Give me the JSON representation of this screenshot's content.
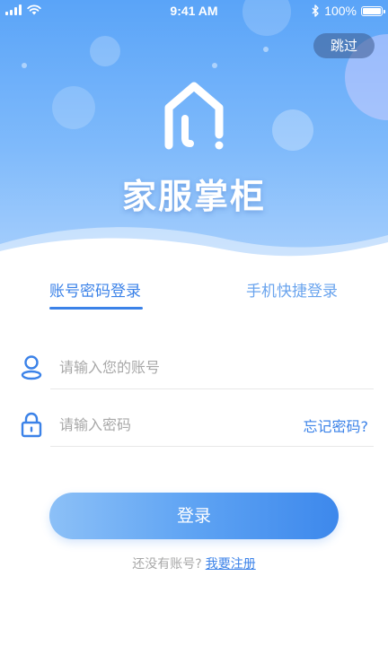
{
  "status_bar": {
    "time": "9:41 AM",
    "battery_percent": "100%",
    "battery_level": 1.0,
    "icons": [
      "signal-bars-icon",
      "wifi-icon",
      "bluetooth-icon",
      "battery-icon"
    ]
  },
  "header": {
    "skip_label": "跳过",
    "app_name": "家服掌柜",
    "logo_icon": "house-logo-icon"
  },
  "tabs": [
    {
      "label": "账号密码登录",
      "active": true
    },
    {
      "label": "手机快捷登录",
      "active": false
    }
  ],
  "form": {
    "account": {
      "placeholder": "请输入您的账号",
      "value": "",
      "icon": "user-icon"
    },
    "password": {
      "placeholder": "请输入密码",
      "value": "",
      "icon": "lock-icon"
    },
    "forgot_label": "忘记密码?"
  },
  "login_button": {
    "label": "登录"
  },
  "register": {
    "prompt": "还没有账号?",
    "link_label": "我要注册"
  },
  "colors": {
    "primary": "#3b82e8",
    "header_gradient_top": "#5aa4f8",
    "header_gradient_bottom": "#a9d0fc",
    "placeholder_gray": "#a8a8a8"
  }
}
